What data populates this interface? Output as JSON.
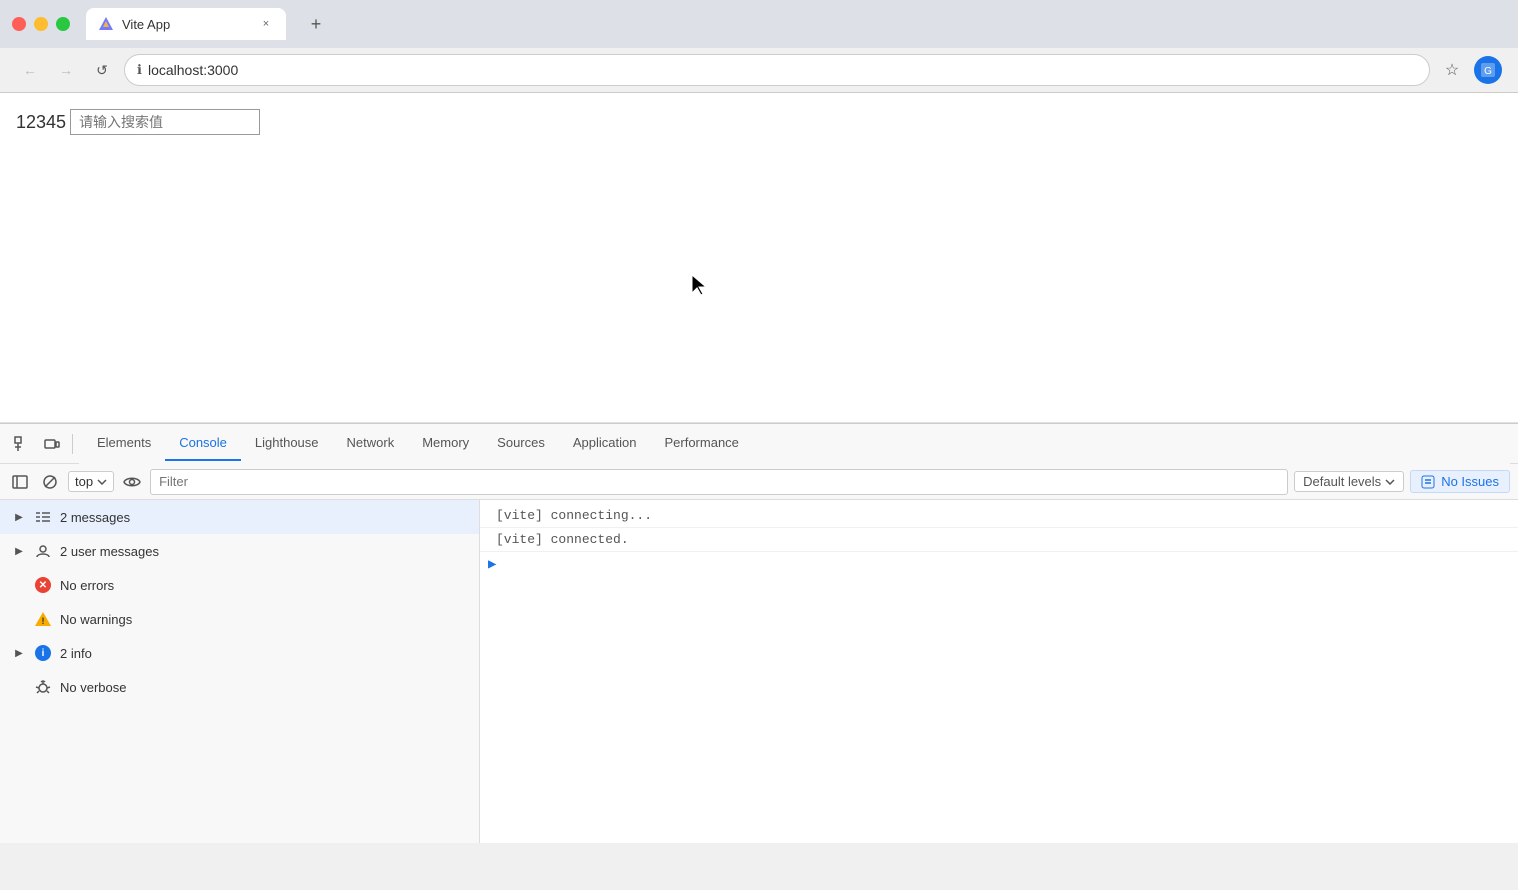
{
  "browser": {
    "tab": {
      "title": "Vite App",
      "close_label": "×",
      "new_tab_label": "+"
    },
    "address": {
      "url": "localhost:3000",
      "info_icon": "ℹ",
      "bookmark_icon": "☆"
    },
    "nav": {
      "back_label": "←",
      "forward_label": "→",
      "reload_label": "↺"
    }
  },
  "page": {
    "number_text": "12345",
    "search_placeholder": "请输入搜索值"
  },
  "devtools": {
    "tabs": [
      {
        "id": "elements",
        "label": "Elements",
        "active": false
      },
      {
        "id": "console",
        "label": "Console",
        "active": true
      },
      {
        "id": "lighthouse",
        "label": "Lighthouse",
        "active": false
      },
      {
        "id": "network",
        "label": "Network",
        "active": false
      },
      {
        "id": "memory",
        "label": "Memory",
        "active": false
      },
      {
        "id": "sources",
        "label": "Sources",
        "active": false
      },
      {
        "id": "application",
        "label": "Application",
        "active": false
      },
      {
        "id": "performance",
        "label": "Performance",
        "active": false
      }
    ],
    "console": {
      "context": "top",
      "filter_placeholder": "Filter",
      "levels_label": "Default levels",
      "no_issues_label": "No Issues",
      "sidebar_items": [
        {
          "id": "messages",
          "label": "2 messages",
          "icon": "list",
          "expandable": true,
          "highlighted": true
        },
        {
          "id": "user-messages",
          "label": "2 user messages",
          "icon": "user",
          "expandable": true,
          "highlighted": false
        },
        {
          "id": "no-errors",
          "label": "No errors",
          "icon": "red-x",
          "expandable": false,
          "highlighted": false
        },
        {
          "id": "no-warnings",
          "label": "No warnings",
          "icon": "yellow-warning",
          "expandable": false,
          "highlighted": false
        },
        {
          "id": "info",
          "label": "2 info",
          "icon": "blue-info",
          "expandable": true,
          "highlighted": false
        },
        {
          "id": "no-verbose",
          "label": "No verbose",
          "icon": "bug",
          "expandable": false,
          "highlighted": false
        }
      ],
      "output_lines": [
        {
          "id": "line1",
          "text": "[vite] connecting..."
        },
        {
          "id": "line2",
          "text": "[vite] connected."
        }
      ]
    }
  }
}
